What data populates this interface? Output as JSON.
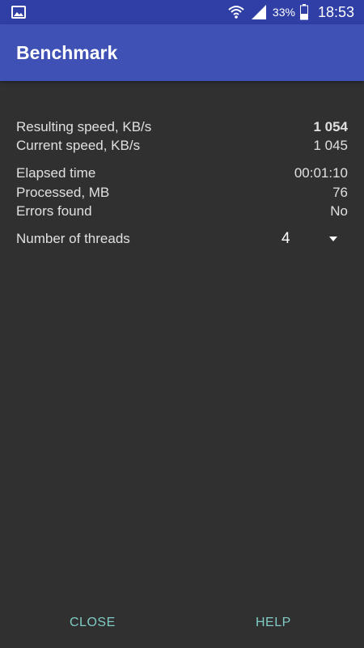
{
  "status_bar": {
    "battery_percent": "33%",
    "time": "18:53",
    "icons": [
      "gallery-icon",
      "wifi-icon",
      "signal-icon",
      "battery-icon"
    ]
  },
  "app_bar": {
    "title": "Benchmark"
  },
  "stats": {
    "resulting_speed": {
      "label": "Resulting speed, KB/s",
      "value": "1 054"
    },
    "current_speed": {
      "label": "Current speed, KB/s",
      "value": "1 045"
    },
    "elapsed_time": {
      "label": "Elapsed time",
      "value": "00:01:10"
    },
    "processed": {
      "label": "Processed, MB",
      "value": "76"
    },
    "errors": {
      "label": "Errors found",
      "value": "No"
    },
    "threads": {
      "label": "Number of threads",
      "value": "4"
    }
  },
  "buttons": {
    "close": "CLOSE",
    "help": "HELP"
  },
  "colors": {
    "status_bar": "#2f3fa5",
    "app_bar": "#3f51b5",
    "background": "#303030",
    "accent": "#80cbc4"
  }
}
